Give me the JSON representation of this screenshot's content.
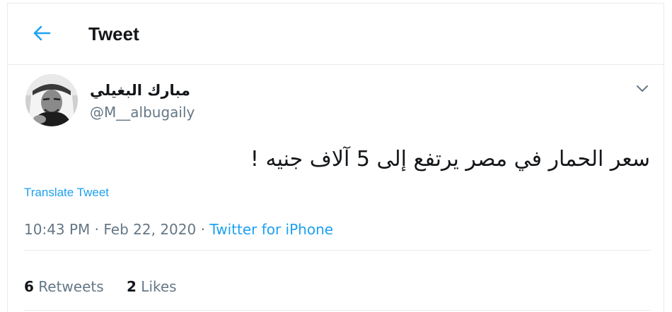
{
  "header": {
    "title": "Tweet",
    "back_icon": "arrow-left-icon"
  },
  "tweet": {
    "display_name": "مبارك البغيلي",
    "handle": "@M__albugaily",
    "text": "سعر الحمار في مصر يرتفع إلى 5 آلاف جنيه !",
    "translate_label": "Translate Tweet",
    "time": "10:43 PM",
    "date": "Feb 22, 2020",
    "separator": "·",
    "source": "Twitter for iPhone",
    "retweets_count": "6",
    "retweets_label": "Retweets",
    "likes_count": "2",
    "likes_label": "Likes"
  },
  "colors": {
    "accent": "#1da1f2",
    "text": "#14171a",
    "secondary": "#657786",
    "border": "#e6ecf0"
  }
}
